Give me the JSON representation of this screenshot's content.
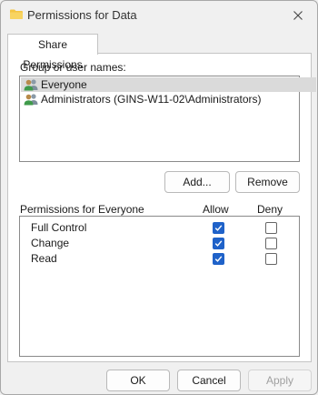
{
  "window": {
    "title": "Permissions for Data",
    "icon": "folder-icon"
  },
  "tabs": [
    {
      "label": "Share Permissions",
      "active": true
    }
  ],
  "group_section": {
    "label": "Group or user names:",
    "items": [
      {
        "label": "Everyone",
        "selected": true,
        "icon": "user-group-icon"
      },
      {
        "label": "Administrators (GINS-W11-02\\Administrators)",
        "selected": false,
        "icon": "user-group-icon"
      }
    ],
    "add_label": "Add...",
    "remove_label": "Remove"
  },
  "permissions": {
    "header": "Permissions for Everyone",
    "allow_label": "Allow",
    "deny_label": "Deny",
    "rows": [
      {
        "name": "Full Control",
        "allow": true,
        "deny": false
      },
      {
        "name": "Change",
        "allow": true,
        "deny": false
      },
      {
        "name": "Read",
        "allow": true,
        "deny": false
      }
    ]
  },
  "footer": {
    "ok_label": "OK",
    "cancel_label": "Cancel",
    "apply_label": "Apply",
    "apply_enabled": false
  },
  "colors": {
    "accent": "#1f62c9",
    "selection": "#dadada",
    "folder": "#f4c542"
  }
}
